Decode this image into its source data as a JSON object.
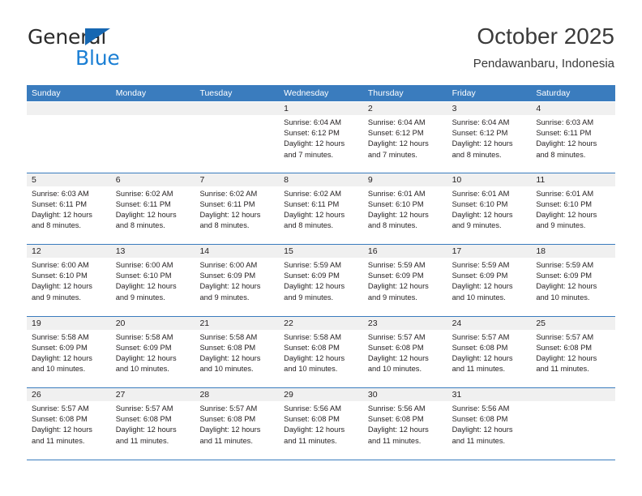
{
  "brand": {
    "line1": "General",
    "line2": "Blue",
    "triangle_color": "#1667b2",
    "blue_text_color": "#1b7fd4"
  },
  "header": {
    "title": "October 2025",
    "subtitle": "Pendawanbaru, Indonesia"
  },
  "theme": {
    "header_band": "#3a7cbe",
    "daynum_strip": "#f0f0f0",
    "text": "#231f20"
  },
  "weekday_headers": [
    "Sunday",
    "Monday",
    "Tuesday",
    "Wednesday",
    "Thursday",
    "Friday",
    "Saturday"
  ],
  "weeks": [
    [
      {
        "day": "",
        "sunrise": "",
        "sunset": "",
        "daylight": "",
        "daylight2": ""
      },
      {
        "day": "",
        "sunrise": "",
        "sunset": "",
        "daylight": "",
        "daylight2": ""
      },
      {
        "day": "",
        "sunrise": "",
        "sunset": "",
        "daylight": "",
        "daylight2": ""
      },
      {
        "day": "1",
        "sunrise": "Sunrise: 6:04 AM",
        "sunset": "Sunset: 6:12 PM",
        "daylight": "Daylight: 12 hours",
        "daylight2": "and 7 minutes."
      },
      {
        "day": "2",
        "sunrise": "Sunrise: 6:04 AM",
        "sunset": "Sunset: 6:12 PM",
        "daylight": "Daylight: 12 hours",
        "daylight2": "and 7 minutes."
      },
      {
        "day": "3",
        "sunrise": "Sunrise: 6:04 AM",
        "sunset": "Sunset: 6:12 PM",
        "daylight": "Daylight: 12 hours",
        "daylight2": "and 8 minutes."
      },
      {
        "day": "4",
        "sunrise": "Sunrise: 6:03 AM",
        "sunset": "Sunset: 6:11 PM",
        "daylight": "Daylight: 12 hours",
        "daylight2": "and 8 minutes."
      }
    ],
    [
      {
        "day": "5",
        "sunrise": "Sunrise: 6:03 AM",
        "sunset": "Sunset: 6:11 PM",
        "daylight": "Daylight: 12 hours",
        "daylight2": "and 8 minutes."
      },
      {
        "day": "6",
        "sunrise": "Sunrise: 6:02 AM",
        "sunset": "Sunset: 6:11 PM",
        "daylight": "Daylight: 12 hours",
        "daylight2": "and 8 minutes."
      },
      {
        "day": "7",
        "sunrise": "Sunrise: 6:02 AM",
        "sunset": "Sunset: 6:11 PM",
        "daylight": "Daylight: 12 hours",
        "daylight2": "and 8 minutes."
      },
      {
        "day": "8",
        "sunrise": "Sunrise: 6:02 AM",
        "sunset": "Sunset: 6:11 PM",
        "daylight": "Daylight: 12 hours",
        "daylight2": "and 8 minutes."
      },
      {
        "day": "9",
        "sunrise": "Sunrise: 6:01 AM",
        "sunset": "Sunset: 6:10 PM",
        "daylight": "Daylight: 12 hours",
        "daylight2": "and 8 minutes."
      },
      {
        "day": "10",
        "sunrise": "Sunrise: 6:01 AM",
        "sunset": "Sunset: 6:10 PM",
        "daylight": "Daylight: 12 hours",
        "daylight2": "and 9 minutes."
      },
      {
        "day": "11",
        "sunrise": "Sunrise: 6:01 AM",
        "sunset": "Sunset: 6:10 PM",
        "daylight": "Daylight: 12 hours",
        "daylight2": "and 9 minutes."
      }
    ],
    [
      {
        "day": "12",
        "sunrise": "Sunrise: 6:00 AM",
        "sunset": "Sunset: 6:10 PM",
        "daylight": "Daylight: 12 hours",
        "daylight2": "and 9 minutes."
      },
      {
        "day": "13",
        "sunrise": "Sunrise: 6:00 AM",
        "sunset": "Sunset: 6:10 PM",
        "daylight": "Daylight: 12 hours",
        "daylight2": "and 9 minutes."
      },
      {
        "day": "14",
        "sunrise": "Sunrise: 6:00 AM",
        "sunset": "Sunset: 6:09 PM",
        "daylight": "Daylight: 12 hours",
        "daylight2": "and 9 minutes."
      },
      {
        "day": "15",
        "sunrise": "Sunrise: 5:59 AM",
        "sunset": "Sunset: 6:09 PM",
        "daylight": "Daylight: 12 hours",
        "daylight2": "and 9 minutes."
      },
      {
        "day": "16",
        "sunrise": "Sunrise: 5:59 AM",
        "sunset": "Sunset: 6:09 PM",
        "daylight": "Daylight: 12 hours",
        "daylight2": "and 9 minutes."
      },
      {
        "day": "17",
        "sunrise": "Sunrise: 5:59 AM",
        "sunset": "Sunset: 6:09 PM",
        "daylight": "Daylight: 12 hours",
        "daylight2": "and 10 minutes."
      },
      {
        "day": "18",
        "sunrise": "Sunrise: 5:59 AM",
        "sunset": "Sunset: 6:09 PM",
        "daylight": "Daylight: 12 hours",
        "daylight2": "and 10 minutes."
      }
    ],
    [
      {
        "day": "19",
        "sunrise": "Sunrise: 5:58 AM",
        "sunset": "Sunset: 6:09 PM",
        "daylight": "Daylight: 12 hours",
        "daylight2": "and 10 minutes."
      },
      {
        "day": "20",
        "sunrise": "Sunrise: 5:58 AM",
        "sunset": "Sunset: 6:09 PM",
        "daylight": "Daylight: 12 hours",
        "daylight2": "and 10 minutes."
      },
      {
        "day": "21",
        "sunrise": "Sunrise: 5:58 AM",
        "sunset": "Sunset: 6:08 PM",
        "daylight": "Daylight: 12 hours",
        "daylight2": "and 10 minutes."
      },
      {
        "day": "22",
        "sunrise": "Sunrise: 5:58 AM",
        "sunset": "Sunset: 6:08 PM",
        "daylight": "Daylight: 12 hours",
        "daylight2": "and 10 minutes."
      },
      {
        "day": "23",
        "sunrise": "Sunrise: 5:57 AM",
        "sunset": "Sunset: 6:08 PM",
        "daylight": "Daylight: 12 hours",
        "daylight2": "and 10 minutes."
      },
      {
        "day": "24",
        "sunrise": "Sunrise: 5:57 AM",
        "sunset": "Sunset: 6:08 PM",
        "daylight": "Daylight: 12 hours",
        "daylight2": "and 11 minutes."
      },
      {
        "day": "25",
        "sunrise": "Sunrise: 5:57 AM",
        "sunset": "Sunset: 6:08 PM",
        "daylight": "Daylight: 12 hours",
        "daylight2": "and 11 minutes."
      }
    ],
    [
      {
        "day": "26",
        "sunrise": "Sunrise: 5:57 AM",
        "sunset": "Sunset: 6:08 PM",
        "daylight": "Daylight: 12 hours",
        "daylight2": "and 11 minutes."
      },
      {
        "day": "27",
        "sunrise": "Sunrise: 5:57 AM",
        "sunset": "Sunset: 6:08 PM",
        "daylight": "Daylight: 12 hours",
        "daylight2": "and 11 minutes."
      },
      {
        "day": "28",
        "sunrise": "Sunrise: 5:57 AM",
        "sunset": "Sunset: 6:08 PM",
        "daylight": "Daylight: 12 hours",
        "daylight2": "and 11 minutes."
      },
      {
        "day": "29",
        "sunrise": "Sunrise: 5:56 AM",
        "sunset": "Sunset: 6:08 PM",
        "daylight": "Daylight: 12 hours",
        "daylight2": "and 11 minutes."
      },
      {
        "day": "30",
        "sunrise": "Sunrise: 5:56 AM",
        "sunset": "Sunset: 6:08 PM",
        "daylight": "Daylight: 12 hours",
        "daylight2": "and 11 minutes."
      },
      {
        "day": "31",
        "sunrise": "Sunrise: 5:56 AM",
        "sunset": "Sunset: 6:08 PM",
        "daylight": "Daylight: 12 hours",
        "daylight2": "and 11 minutes."
      },
      {
        "day": "",
        "sunrise": "",
        "sunset": "",
        "daylight": "",
        "daylight2": ""
      }
    ]
  ]
}
